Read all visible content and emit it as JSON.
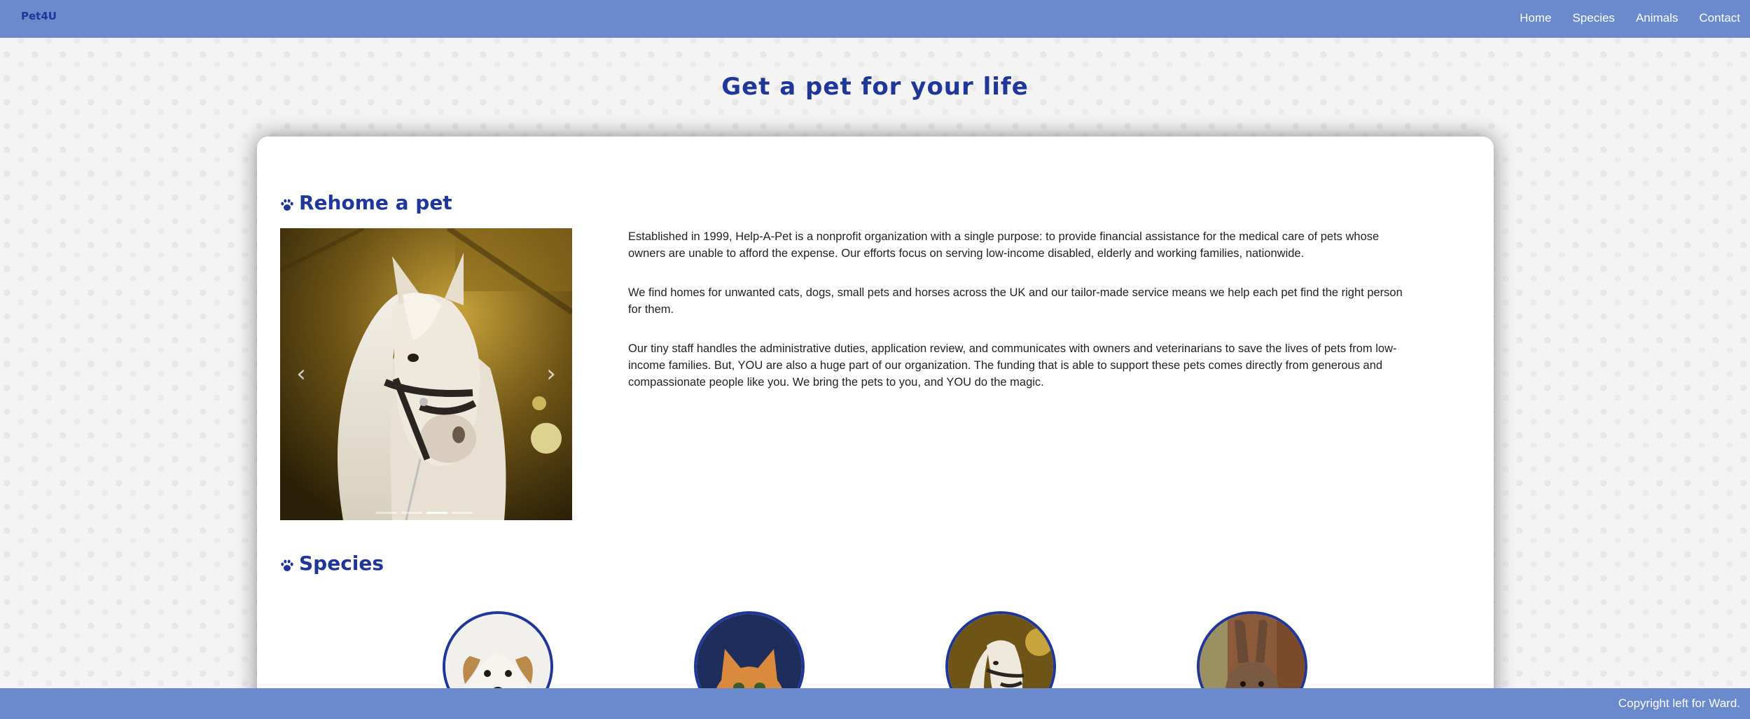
{
  "navbar": {
    "brand": "Pet4U",
    "links": [
      "Home",
      "Species",
      "Animals",
      "Contact"
    ]
  },
  "page": {
    "title": "Get a pet for your life"
  },
  "rehome": {
    "heading": "Rehome a pet",
    "carousel": {
      "prev_icon": "chevron-left-icon",
      "next_icon": "chevron-right-icon",
      "indicator_count": 4,
      "active_index": 2
    },
    "paragraphs": [
      "Established in 1999, Help-A-Pet is a nonprofit organization with a single purpose: to provide financial assistance for the medical care of pets whose owners are unable to afford the expense. Our efforts focus on serving low-income disabled, elderly and working families, nationwide.",
      "We find homes for unwanted cats, dogs, small pets and horses across the UK and our tailor-made service means we help each pet find the right person for them.",
      "Our tiny staff handles the administrative duties, application review, and communicates with owners and veterinarians to save the lives of pets from low-income families. But, YOU are also a huge part of our organization. The funding that is able to support these pets comes directly from generous and compassionate people like you. We bring the pets to you, and YOU do the magic."
    ]
  },
  "species": {
    "heading": "Species",
    "items": [
      "dog",
      "cat",
      "horse",
      "rabbit"
    ]
  },
  "footer": {
    "text": "Copyright left for Ward."
  },
  "colors": {
    "navbar": "#6b89cd",
    "accent": "#1e3799",
    "card": "#ffffff"
  }
}
